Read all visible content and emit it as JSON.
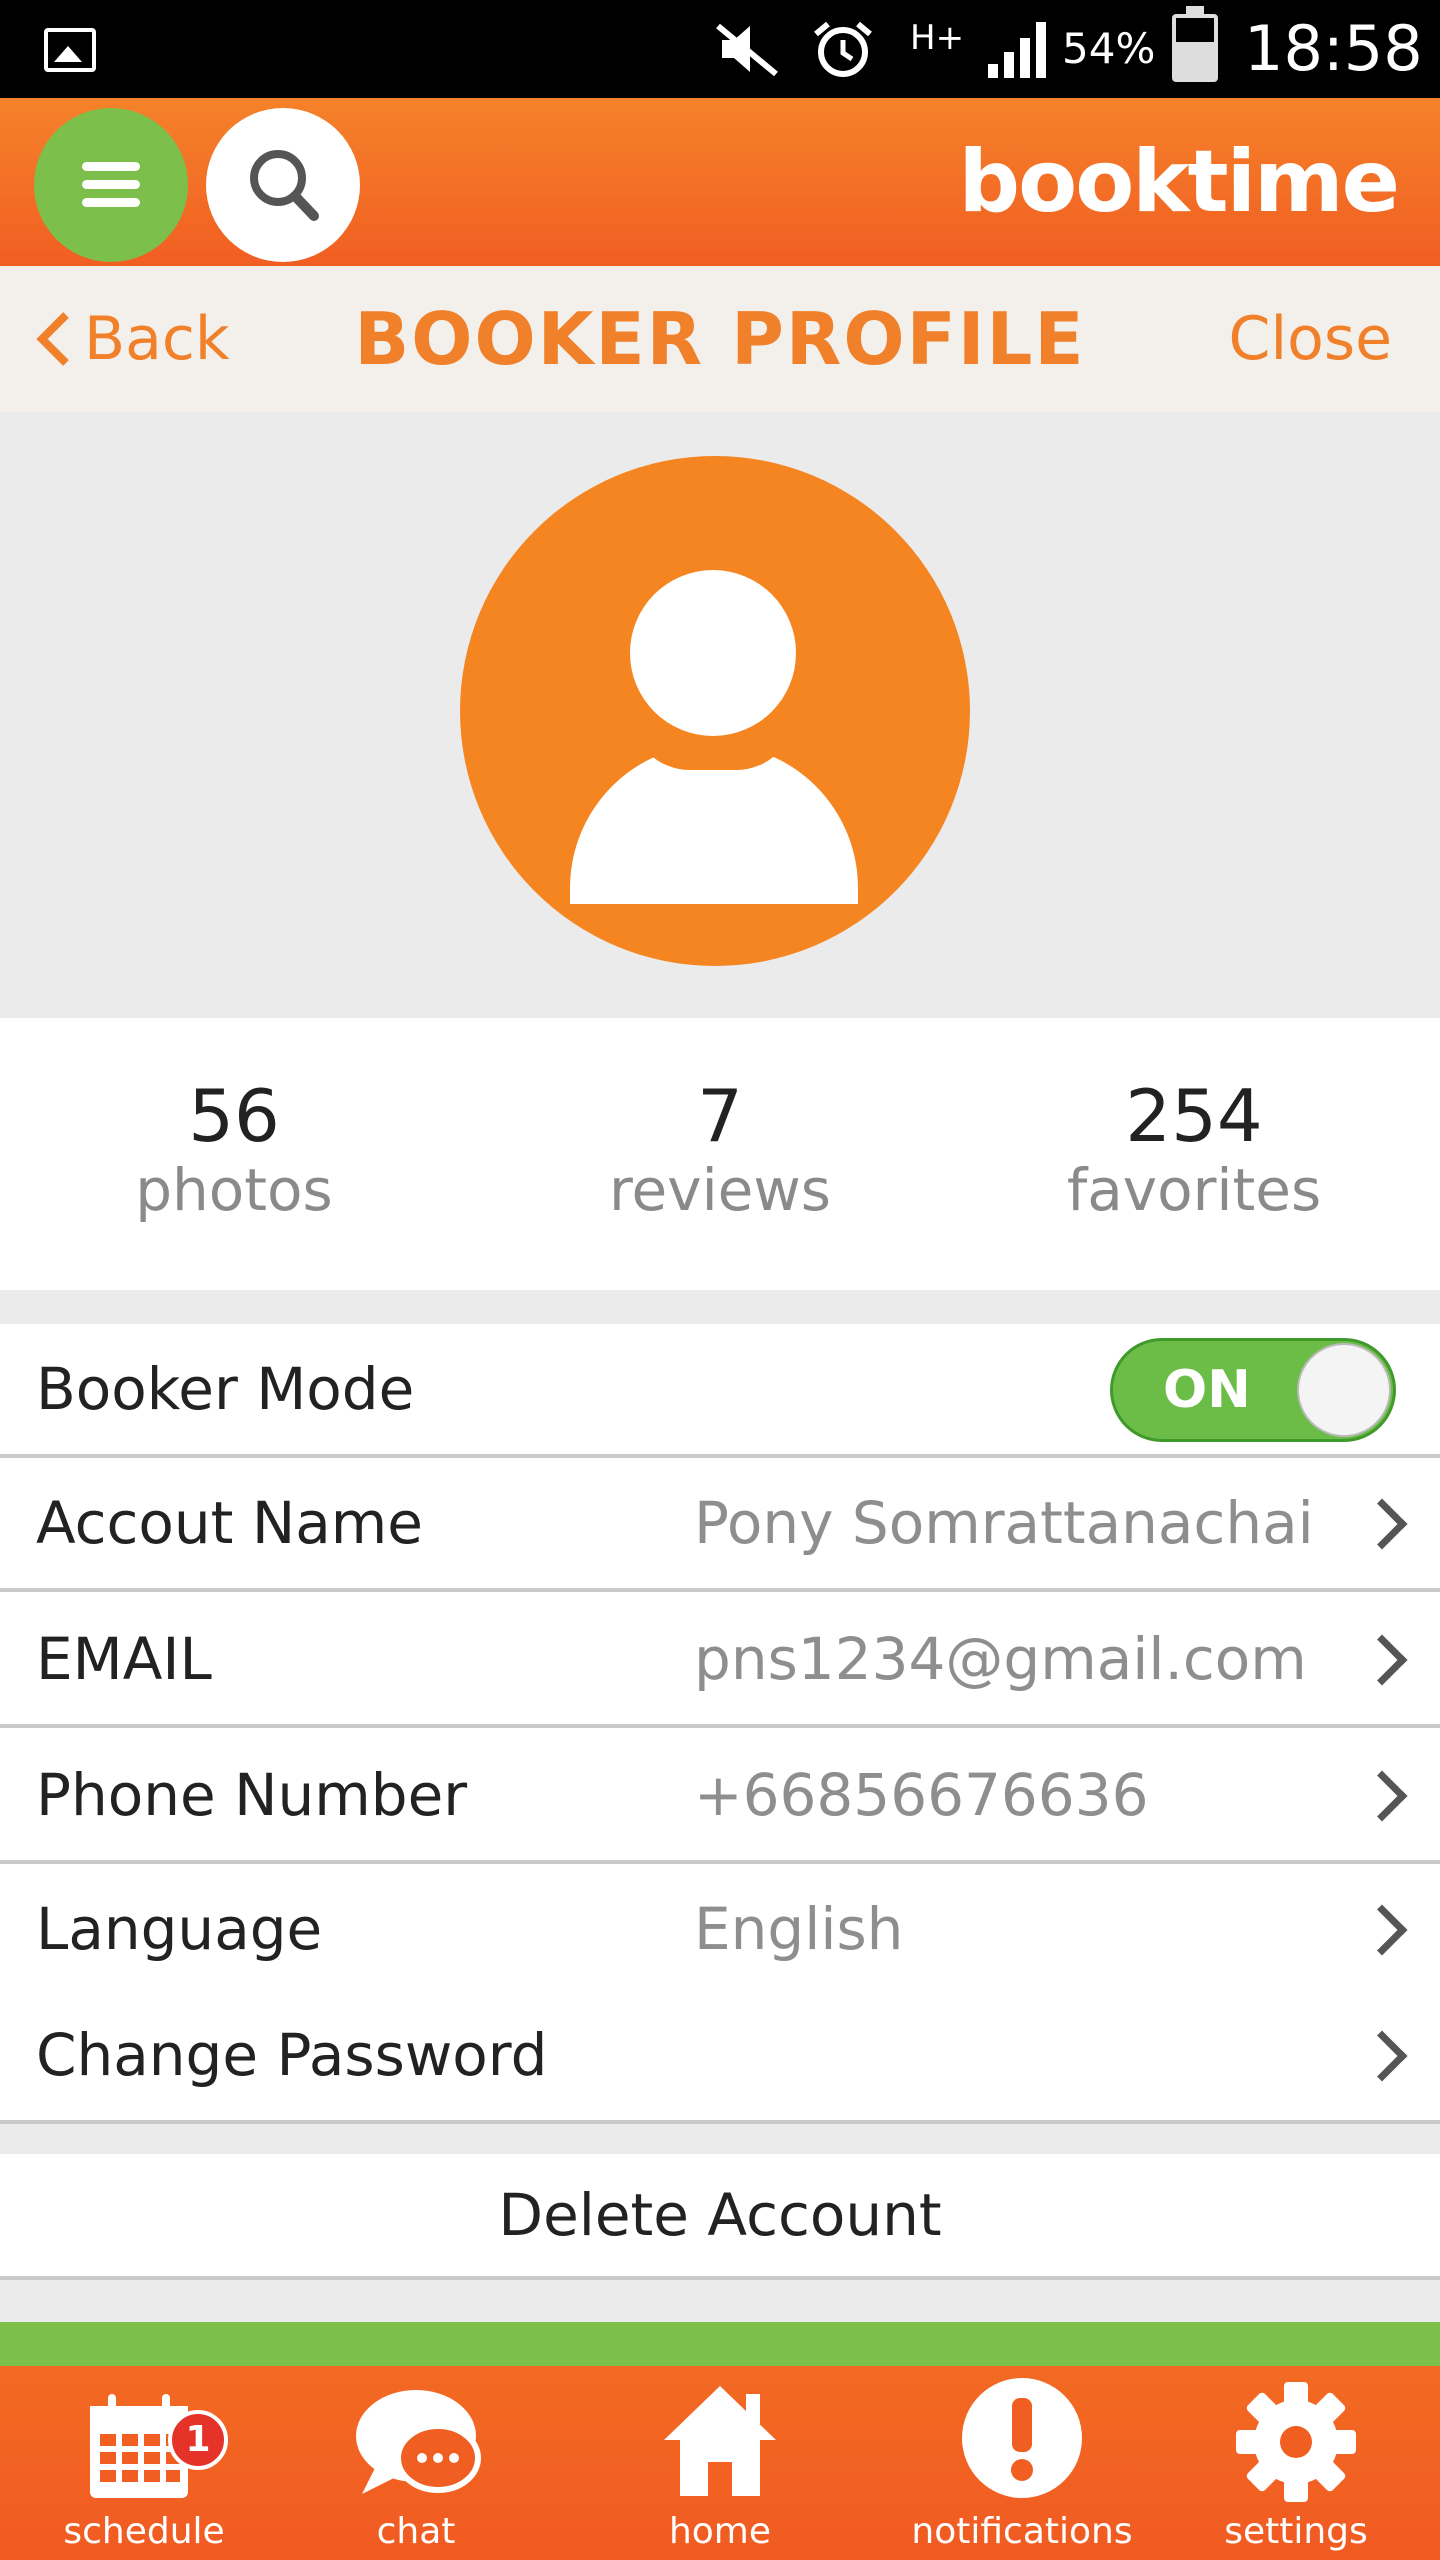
{
  "status_bar": {
    "network": "H+",
    "battery": "54%",
    "time": "18:58"
  },
  "app_bar": {
    "brand": "booktime"
  },
  "title_bar": {
    "back_label": "Back",
    "title": "BOOKER PROFILE",
    "close_label": "Close"
  },
  "stats": [
    {
      "value": "56",
      "label": "photos"
    },
    {
      "value": "7",
      "label": "reviews"
    },
    {
      "value": "254",
      "label": "favorites"
    }
  ],
  "settings": {
    "booker_mode": {
      "label": "Booker Mode",
      "toggle": "ON"
    },
    "rows": [
      {
        "label": "Accout Name",
        "value": "Pony Somrattanachai"
      },
      {
        "label": "EMAIL",
        "value": "pns1234@gmail.com"
      },
      {
        "label": "Phone Number",
        "value": "+66856676636"
      },
      {
        "label": "Language",
        "value": "English"
      },
      {
        "label": "Change Password",
        "value": ""
      }
    ],
    "delete_label": "Delete Account"
  },
  "bottom_nav": {
    "items": [
      {
        "label": "schedule",
        "icon": "calendar-icon",
        "badge": "1"
      },
      {
        "label": "chat",
        "icon": "chat-bubble-icon"
      },
      {
        "label": "home",
        "icon": "home-icon"
      },
      {
        "label": "notifications",
        "icon": "exclamation-icon"
      },
      {
        "label": "settings",
        "icon": "gear-icon"
      }
    ]
  },
  "colors": {
    "brand_orange": "#f5822a",
    "accent_green": "#7cc04b",
    "badge_red": "#e5332a"
  }
}
